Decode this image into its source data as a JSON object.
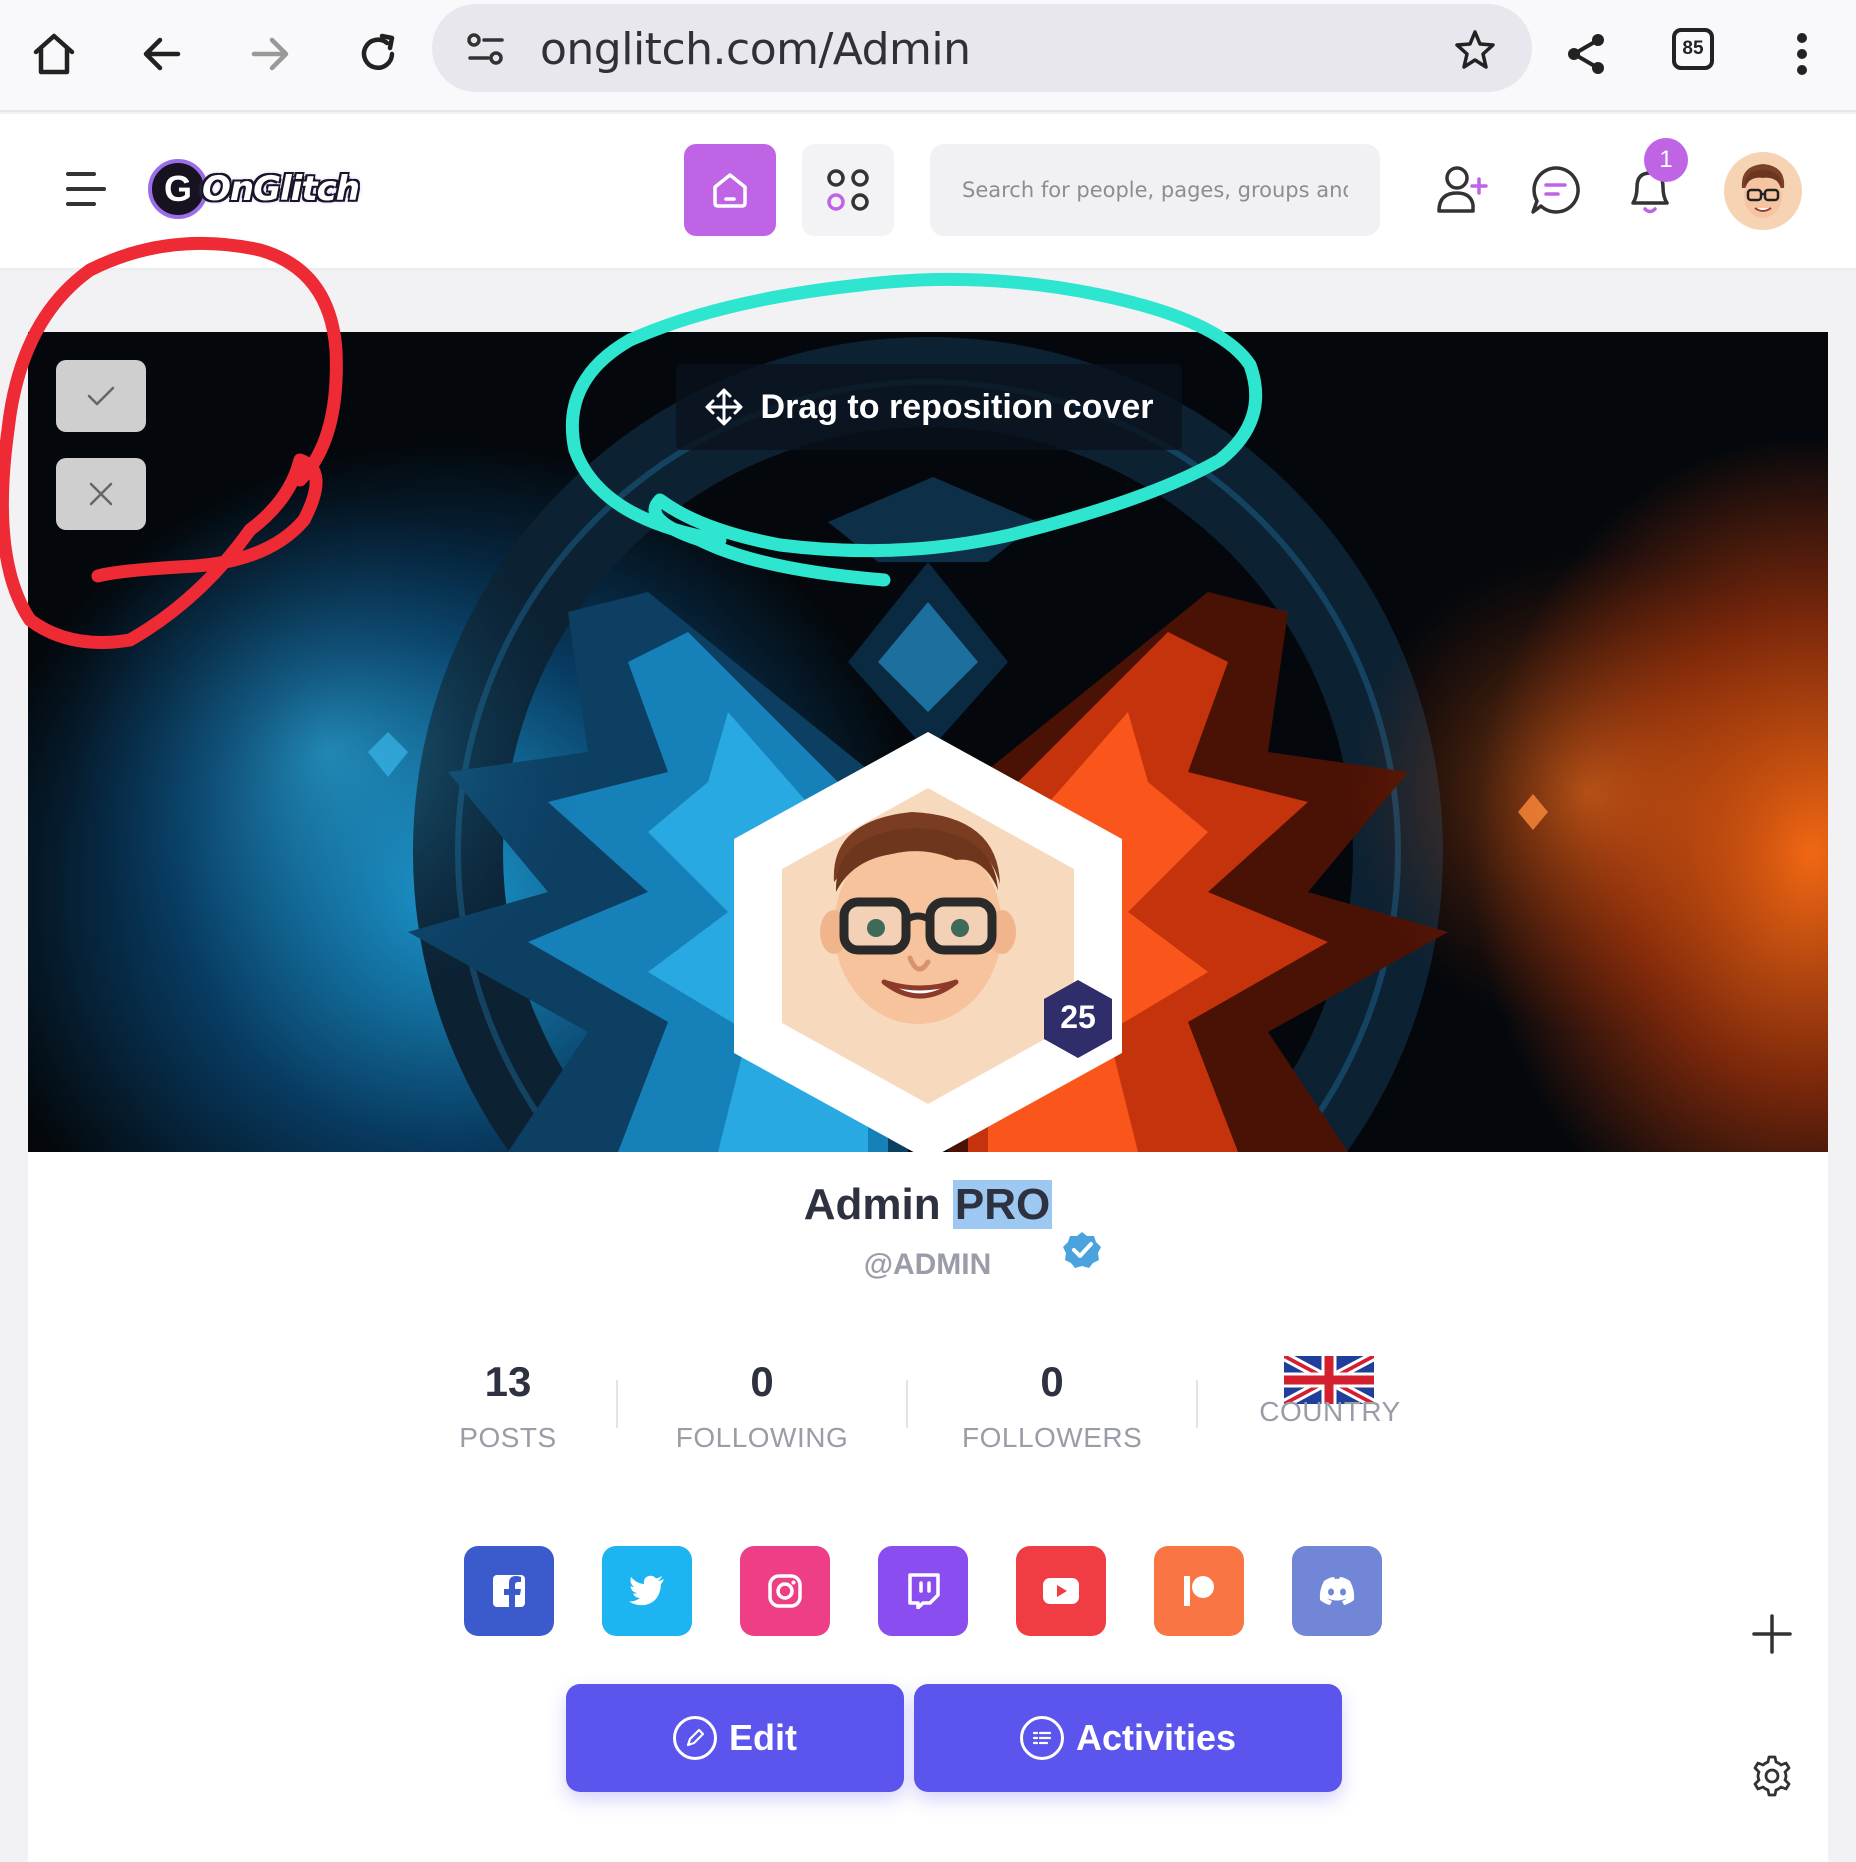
{
  "browser": {
    "url": "onglitch.com/Admin",
    "tab_count": "85"
  },
  "header": {
    "logo_text": "OnGlitch",
    "logo_mark": "G",
    "search_placeholder": "Search for people, pages, groups and #hashtags",
    "notification_count": "1"
  },
  "cover": {
    "drag_hint": "Drag to reposition cover",
    "level": "25"
  },
  "profile": {
    "name_first": "Admin",
    "name_highlight": "PRO",
    "handle": "@ADMIN",
    "stats": [
      {
        "value": "13",
        "label": "POSTS"
      },
      {
        "value": "0",
        "label": "FOLLOWING"
      },
      {
        "value": "0",
        "label": "FOLLOWERS"
      }
    ],
    "country_label": "COUNTRY"
  },
  "social": [
    {
      "name": "facebook-icon",
      "color": "#3b5bcc"
    },
    {
      "name": "twitter-icon",
      "color": "#1db4f2"
    },
    {
      "name": "instagram-icon",
      "color": "#ee3f86"
    },
    {
      "name": "twitch-icon",
      "color": "#8a4ef0"
    },
    {
      "name": "youtube-icon",
      "color": "#f03d43"
    },
    {
      "name": "patreon-icon",
      "color": "#fa7544"
    },
    {
      "name": "discord-icon",
      "color": "#7186d6"
    }
  ],
  "actions": {
    "edit_label": "Edit",
    "activities_label": "Activities"
  },
  "colors": {
    "accent": "#c064e6",
    "button": "#5b55ee",
    "annotation_red": "#ee2a35",
    "annotation_teal": "#2ee6cf"
  }
}
